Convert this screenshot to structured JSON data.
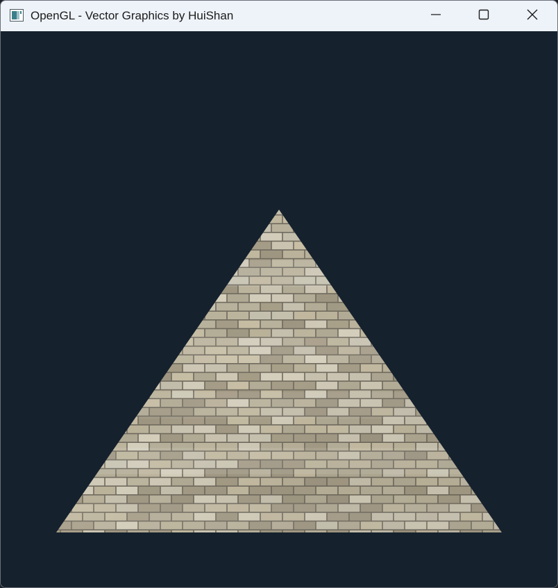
{
  "window": {
    "title": "OpenGL - Vector Graphics by HuiShan",
    "controls": {
      "minimize_icon": "minimize-icon",
      "maximize_icon": "maximize-icon",
      "close_icon": "close-icon"
    }
  },
  "scene": {
    "background_color": "#15212d",
    "shape": "triangle",
    "texture": "brick-wall",
    "brick_colors": [
      "#d6d0bd",
      "#c9c0a6",
      "#bdb69f",
      "#a9a08a"
    ],
    "mortar_color": "#6f6a5e"
  }
}
